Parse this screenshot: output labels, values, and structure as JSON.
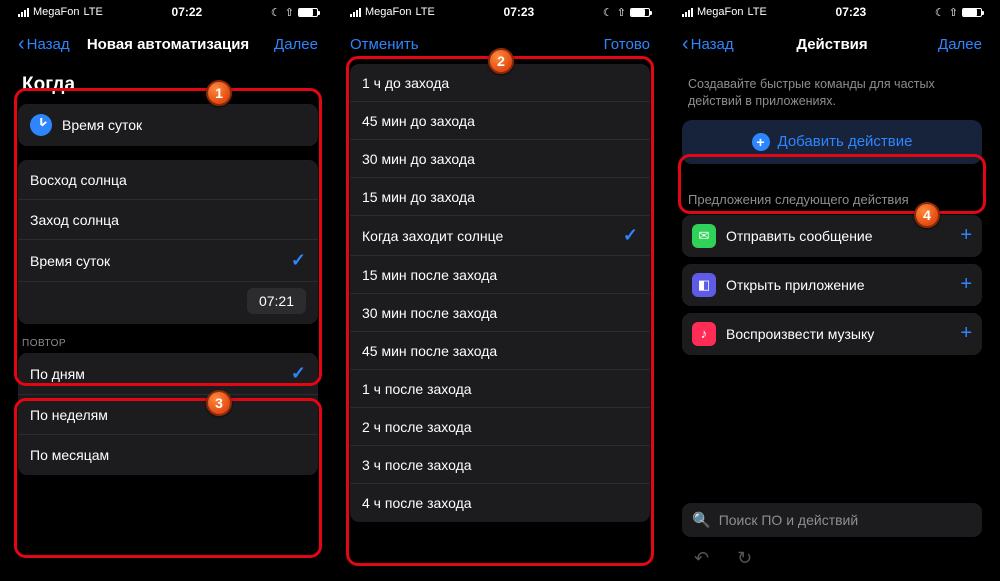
{
  "status": {
    "carrier": "MegaFon",
    "net": "LTE",
    "t1": "07:22",
    "t2": "07:23",
    "t3": "07:23"
  },
  "nav": {
    "back": "Назад",
    "next": "Далее",
    "title1": "Новая автоматизация",
    "cancel": "Отменить",
    "done": "Готово",
    "title3": "Действия"
  },
  "p1": {
    "when": "Когда",
    "timeOfDay": "Время суток",
    "sunrise": "Восход солнца",
    "sunset": "Заход солнца",
    "timeOfDay2": "Время суток",
    "time": "07:21",
    "repeat": "ПОВТОР",
    "daily": "По дням",
    "weekly": "По неделям",
    "monthly": "По месяцам"
  },
  "p2": {
    "items": [
      "1 ч до захода",
      "45 мин до захода",
      "30 мин до захода",
      "15 мин до захода",
      "Когда заходит солнце",
      "15 мин после захода",
      "30 мин после захода",
      "45 мин после захода",
      "1 ч после захода",
      "2 ч после захода",
      "3 ч после захода",
      "4 ч после захода"
    ],
    "selected": 4
  },
  "p3": {
    "help": "Создавайте быстрые команды для частых действий в приложениях.",
    "add": "Добавить действие",
    "sugg": "Предложения следующего действия",
    "s1": "Отправить сообщение",
    "s2": "Открыть приложение",
    "s3": "Воспроизвести музыку",
    "search": "Поиск ПО и действий"
  },
  "badges": {
    "b1": "1",
    "b2": "2",
    "b3": "3",
    "b4": "4"
  }
}
